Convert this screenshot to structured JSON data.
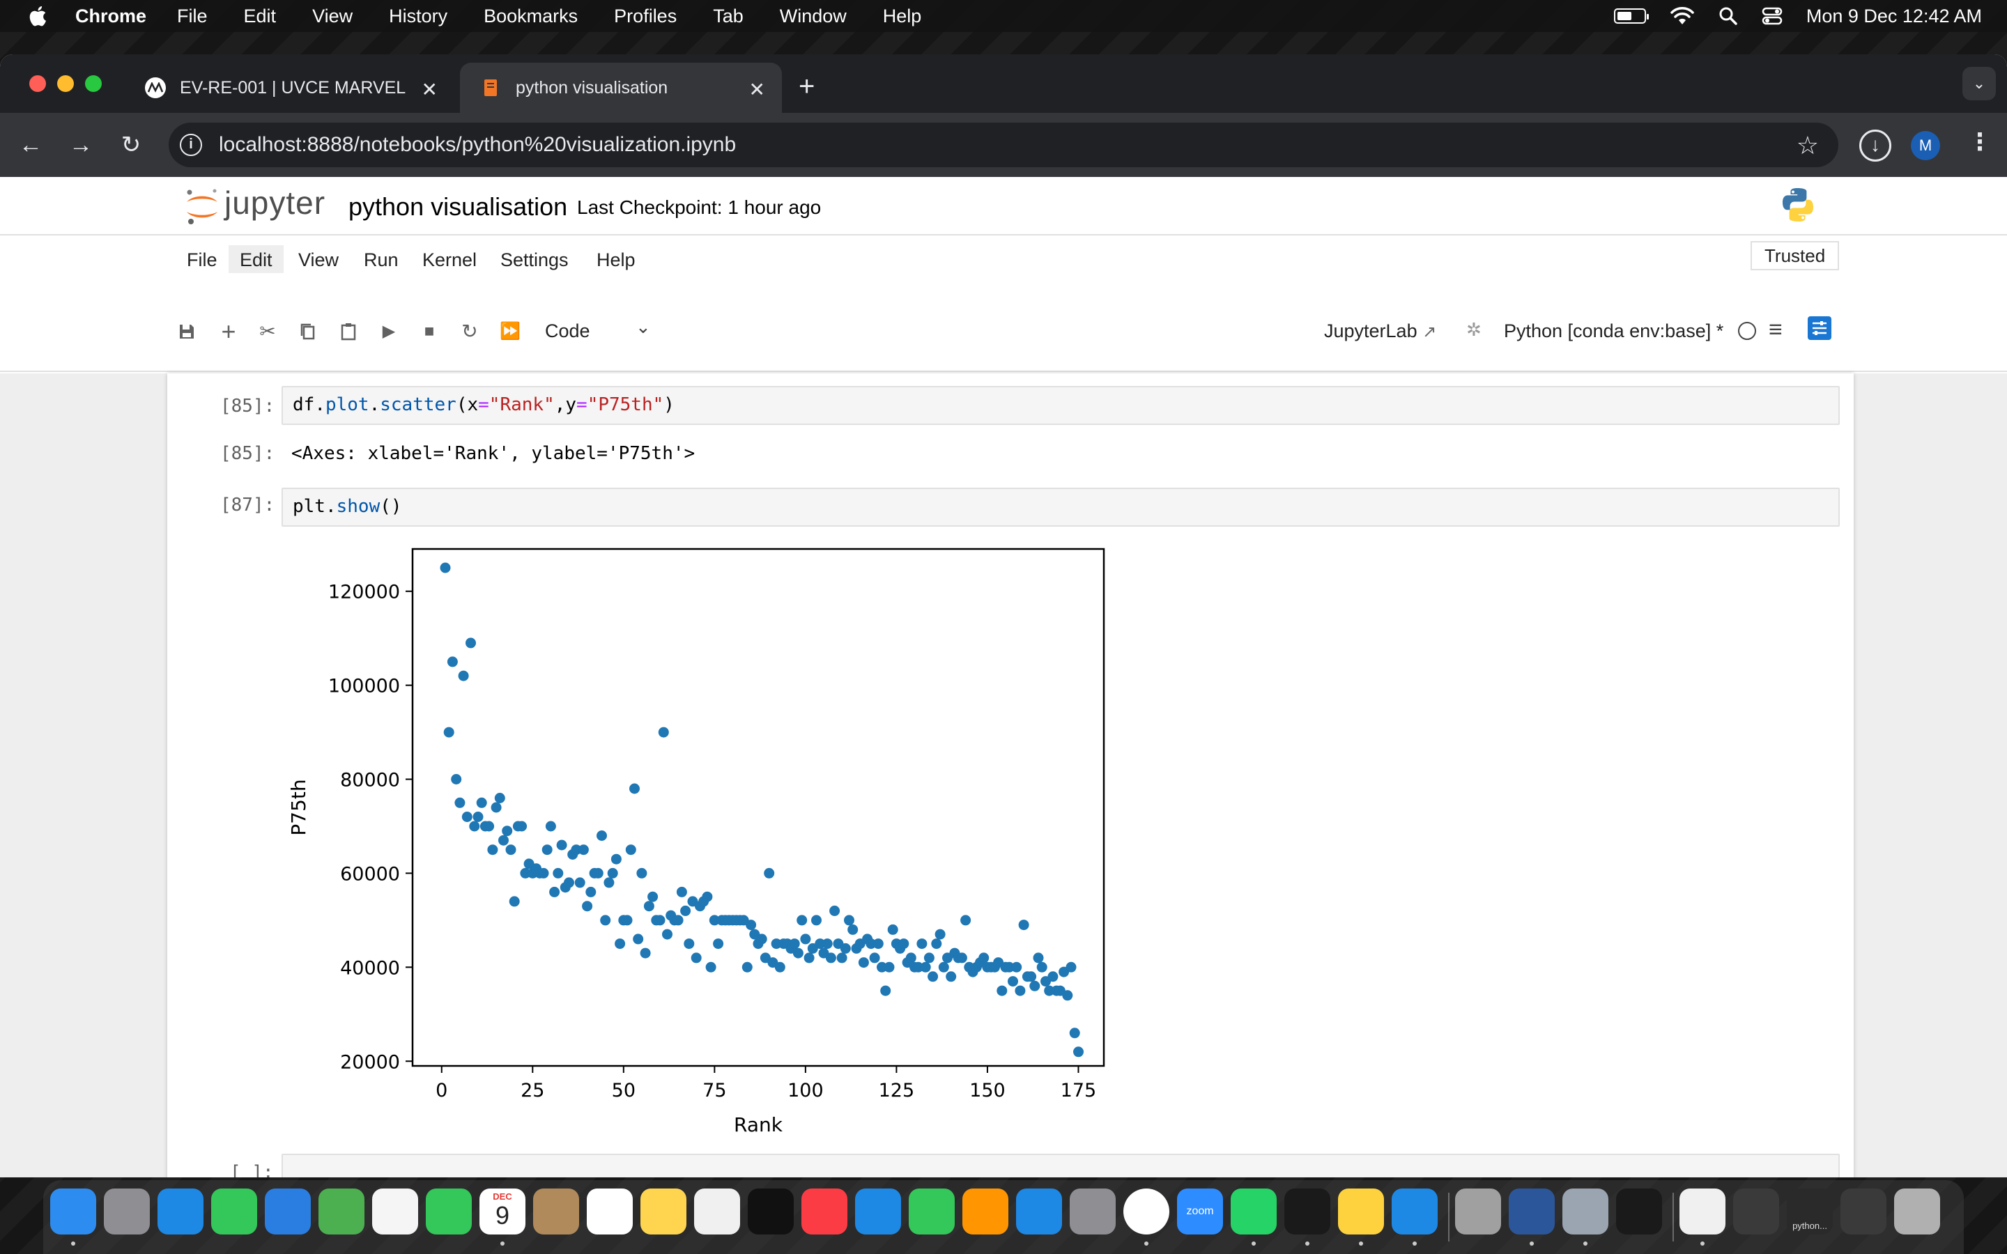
{
  "menubar": {
    "app": "Chrome",
    "items": [
      "File",
      "Edit",
      "View",
      "History",
      "Bookmarks",
      "Profiles",
      "Tab",
      "Window",
      "Help"
    ],
    "clock": "Mon 9 Dec  12:42 AM"
  },
  "browser": {
    "tabs": [
      {
        "title": "EV-RE-001 | UVCE MARVEL",
        "active": false
      },
      {
        "title": "python visualisation",
        "active": true
      }
    ],
    "url": "localhost:8888/notebooks/python%20visualization.ipynb",
    "profile_initial": "M"
  },
  "jupyter": {
    "logo_text": "jupyter",
    "notebook_title": "python visualisation",
    "checkpoint": "Last Checkpoint: 1 hour ago",
    "menu": [
      "File",
      "Edit",
      "View",
      "Run",
      "Kernel",
      "Settings",
      "Help"
    ],
    "trusted": "Trusted",
    "cell_type": "Code",
    "jupyterlab_link": "JupyterLab",
    "kernel_name": "Python [conda env:base] *"
  },
  "cells": [
    {
      "prompt": "[85]:",
      "code_parts": [
        "df",
        ".",
        "plot",
        ".",
        "scatter",
        "(x",
        "=",
        "\"Rank\"",
        ",y",
        "=",
        "\"P75th\"",
        ")"
      ]
    },
    {
      "prompt": "[85]:",
      "output": "<Axes: xlabel='Rank', ylabel='P75th'>"
    },
    {
      "prompt": "[87]:",
      "code_parts": [
        "plt",
        ".",
        "show",
        "()"
      ]
    },
    {
      "prompt": "[ ]:",
      "code": ""
    }
  ],
  "chart_data": {
    "type": "scatter",
    "xlabel": "Rank",
    "ylabel": "P75th",
    "xlim": [
      -8,
      182
    ],
    "ylim": [
      19000,
      129000
    ],
    "xticks": [
      0,
      25,
      50,
      75,
      100,
      125,
      150,
      175
    ],
    "yticks": [
      20000,
      40000,
      60000,
      80000,
      100000,
      120000
    ],
    "ytick_labels": [
      "20000",
      "40000",
      "60000",
      "80000",
      "100000",
      "120000"
    ],
    "color": "#1f77b4",
    "points": [
      [
        1,
        125000
      ],
      [
        2,
        90000
      ],
      [
        3,
        105000
      ],
      [
        4,
        80000
      ],
      [
        5,
        75000
      ],
      [
        6,
        102000
      ],
      [
        7,
        72000
      ],
      [
        8,
        109000
      ],
      [
        9,
        70000
      ],
      [
        10,
        72000
      ],
      [
        11,
        75000
      ],
      [
        12,
        70000
      ],
      [
        13,
        70000
      ],
      [
        14,
        65000
      ],
      [
        15,
        74000
      ],
      [
        16,
        76000
      ],
      [
        17,
        67000
      ],
      [
        18,
        69000
      ],
      [
        19,
        65000
      ],
      [
        20,
        54000
      ],
      [
        21,
        70000
      ],
      [
        22,
        70000
      ],
      [
        23,
        60000
      ],
      [
        24,
        62000
      ],
      [
        25,
        60000
      ],
      [
        26,
        61000
      ],
      [
        27,
        60000
      ],
      [
        28,
        60000
      ],
      [
        29,
        65000
      ],
      [
        30,
        70000
      ],
      [
        31,
        56000
      ],
      [
        32,
        60000
      ],
      [
        33,
        66000
      ],
      [
        34,
        57000
      ],
      [
        35,
        58000
      ],
      [
        36,
        64000
      ],
      [
        37,
        65000
      ],
      [
        38,
        58000
      ],
      [
        39,
        65000
      ],
      [
        40,
        53000
      ],
      [
        41,
        56000
      ],
      [
        42,
        60000
      ],
      [
        43,
        60000
      ],
      [
        44,
        68000
      ],
      [
        45,
        50000
      ],
      [
        46,
        58000
      ],
      [
        47,
        60000
      ],
      [
        48,
        63000
      ],
      [
        49,
        45000
      ],
      [
        50,
        50000
      ],
      [
        51,
        50000
      ],
      [
        52,
        65000
      ],
      [
        53,
        78000
      ],
      [
        54,
        46000
      ],
      [
        55,
        60000
      ],
      [
        56,
        43000
      ],
      [
        57,
        53000
      ],
      [
        58,
        55000
      ],
      [
        59,
        50000
      ],
      [
        60,
        50000
      ],
      [
        61,
        90000
      ],
      [
        62,
        47000
      ],
      [
        63,
        51000
      ],
      [
        64,
        50000
      ],
      [
        65,
        50000
      ],
      [
        66,
        56000
      ],
      [
        67,
        52000
      ],
      [
        68,
        45000
      ],
      [
        69,
        54000
      ],
      [
        70,
        42000
      ],
      [
        71,
        53000
      ],
      [
        72,
        54000
      ],
      [
        73,
        55000
      ],
      [
        74,
        40000
      ],
      [
        75,
        50000
      ],
      [
        76,
        45000
      ],
      [
        77,
        50000
      ],
      [
        78,
        50000
      ],
      [
        79,
        50000
      ],
      [
        80,
        50000
      ],
      [
        81,
        50000
      ],
      [
        82,
        50000
      ],
      [
        83,
        50000
      ],
      [
        84,
        40000
      ],
      [
        85,
        49000
      ],
      [
        86,
        47000
      ],
      [
        87,
        45000
      ],
      [
        88,
        46000
      ],
      [
        89,
        42000
      ],
      [
        90,
        60000
      ],
      [
        91,
        41000
      ],
      [
        92,
        45000
      ],
      [
        93,
        40000
      ],
      [
        94,
        45000
      ],
      [
        95,
        45000
      ],
      [
        96,
        44000
      ],
      [
        97,
        45000
      ],
      [
        98,
        43000
      ],
      [
        99,
        50000
      ],
      [
        100,
        46000
      ],
      [
        101,
        42000
      ],
      [
        102,
        44000
      ],
      [
        103,
        50000
      ],
      [
        104,
        45000
      ],
      [
        105,
        43000
      ],
      [
        106,
        45000
      ],
      [
        107,
        42000
      ],
      [
        108,
        52000
      ],
      [
        109,
        45000
      ],
      [
        110,
        42000
      ],
      [
        111,
        44000
      ],
      [
        112,
        50000
      ],
      [
        113,
        48000
      ],
      [
        114,
        44000
      ],
      [
        115,
        45000
      ],
      [
        116,
        41000
      ],
      [
        117,
        46000
      ],
      [
        118,
        45000
      ],
      [
        119,
        42000
      ],
      [
        120,
        45000
      ],
      [
        121,
        40000
      ],
      [
        122,
        35000
      ],
      [
        123,
        40000
      ],
      [
        124,
        48000
      ],
      [
        125,
        45000
      ],
      [
        126,
        44000
      ],
      [
        127,
        45000
      ],
      [
        128,
        41000
      ],
      [
        129,
        42000
      ],
      [
        130,
        40000
      ],
      [
        131,
        40000
      ],
      [
        132,
        45000
      ],
      [
        133,
        40000
      ],
      [
        134,
        42000
      ],
      [
        135,
        38000
      ],
      [
        136,
        45000
      ],
      [
        137,
        47000
      ],
      [
        138,
        40000
      ],
      [
        139,
        42000
      ],
      [
        140,
        38000
      ],
      [
        141,
        43000
      ],
      [
        142,
        42000
      ],
      [
        143,
        42000
      ],
      [
        144,
        50000
      ],
      [
        145,
        40000
      ],
      [
        146,
        39000
      ],
      [
        147,
        40000
      ],
      [
        148,
        41000
      ],
      [
        149,
        42000
      ],
      [
        150,
        40000
      ],
      [
        151,
        40000
      ],
      [
        152,
        40000
      ],
      [
        153,
        41000
      ],
      [
        154,
        35000
      ],
      [
        155,
        40000
      ],
      [
        156,
        40000
      ],
      [
        157,
        37000
      ],
      [
        158,
        40000
      ],
      [
        159,
        35000
      ],
      [
        160,
        49000
      ],
      [
        161,
        38000
      ],
      [
        162,
        38000
      ],
      [
        163,
        36000
      ],
      [
        164,
        42000
      ],
      [
        165,
        40000
      ],
      [
        166,
        37000
      ],
      [
        167,
        35000
      ],
      [
        168,
        38000
      ],
      [
        169,
        35000
      ],
      [
        170,
        35000
      ],
      [
        171,
        39000
      ],
      [
        172,
        34000
      ],
      [
        173,
        40000
      ],
      [
        174,
        26000
      ],
      [
        175,
        22000
      ]
    ]
  },
  "dock": {
    "icons": [
      "finder",
      "launchpad",
      "safari",
      "messages",
      "mail",
      "maps",
      "photos",
      "facetime",
      "calendar",
      "contacts",
      "reminders",
      "notes",
      "freeform",
      "tv",
      "music",
      "keynote",
      "numbers",
      "pages",
      "app-store",
      "system-settings",
      "chrome",
      "zoom",
      "whatsapp",
      "terminal",
      "python",
      "vscode",
      "xcode-tools",
      "word",
      "preview",
      "activity",
      "documents",
      "window-1",
      "window-2",
      "window-3",
      "trash"
    ],
    "calendar_month": "DEC",
    "calendar_day": "9",
    "zoom_label": "zoom",
    "window_label": "python..."
  }
}
